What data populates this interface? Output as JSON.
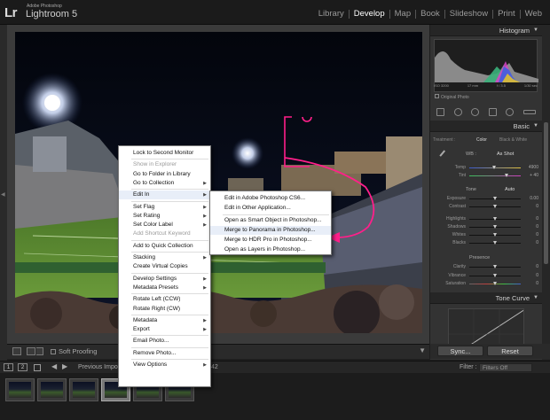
{
  "app": {
    "logo": "Lr",
    "vendor": "Adobe Photoshop",
    "name": "Lightroom 5"
  },
  "modules": [
    {
      "label": "Library",
      "active": false
    },
    {
      "label": "Develop",
      "active": true
    },
    {
      "label": "Map",
      "active": false
    },
    {
      "label": "Book",
      "active": false
    },
    {
      "label": "Slideshow",
      "active": false
    },
    {
      "label": "Print",
      "active": false
    },
    {
      "label": "Web",
      "active": false
    }
  ],
  "toolbar": {
    "soft_proofing": "Soft Proofing"
  },
  "right_panel": {
    "histogram_title": "Histogram",
    "hist_info": [
      "ISO 3200",
      "17 mm",
      "f / 3.5",
      "1/30 sec"
    ],
    "original_photo": "Original Photo",
    "basic_title": "Basic",
    "treatment": [
      "Treatment :",
      "Color",
      "Black & White"
    ],
    "wb_label": "WB :",
    "wb_value": "As Shot",
    "temp_label": "Temp",
    "temp_value": "4900",
    "tint_label": "Tint",
    "tint_value": "+ 40",
    "tone_label": "Tone",
    "tone_auto": "Auto",
    "exposure_label": "Exposure",
    "exposure_value": "0.00",
    "contrast_label": "Contrast",
    "contrast_value": "0",
    "highlights_label": "Highlights",
    "highlights_value": "0",
    "shadows_label": "Shadows",
    "shadows_value": "0",
    "whites_label": "Whites",
    "whites_value": "0",
    "blacks_label": "Blacks",
    "blacks_value": "0",
    "presence_label": "Presence",
    "clarity_label": "Clarity",
    "clarity_value": "0",
    "vibrance_label": "Vibrance",
    "vibrance_value": "0",
    "saturation_label": "Saturation",
    "saturation_value": "0",
    "tone_curve_title": "Tone Curve"
  },
  "buttons": {
    "sync": "Sync...",
    "reset": "Reset"
  },
  "filmbar": {
    "btn1": "1",
    "btn2": "2",
    "source": "Previous Import",
    "count": "42",
    "filter_label": "Filter :",
    "filter_value": "Filters Off"
  },
  "context_menu": [
    {
      "label": "Lock to Second Monitor",
      "disabled": false,
      "submenu": false
    },
    {
      "sep": true
    },
    {
      "label": "Show in Explorer",
      "disabled": true,
      "submenu": false
    },
    {
      "label": "Go to Folder in Library",
      "disabled": false,
      "submenu": false
    },
    {
      "label": "Go to Collection",
      "disabled": false,
      "submenu": true
    },
    {
      "sep": true
    },
    {
      "label": "Edit In",
      "disabled": false,
      "submenu": true,
      "highlight": true
    },
    {
      "sep": true
    },
    {
      "label": "Set Flag",
      "disabled": false,
      "submenu": true
    },
    {
      "label": "Set Rating",
      "disabled": false,
      "submenu": true
    },
    {
      "label": "Set Color Label",
      "disabled": false,
      "submenu": true
    },
    {
      "label": "Add Shortcut Keyword",
      "disabled": true,
      "submenu": false
    },
    {
      "sep": true
    },
    {
      "label": "Add to Quick Collection",
      "disabled": false,
      "submenu": false
    },
    {
      "sep": true
    },
    {
      "label": "Stacking",
      "disabled": false,
      "submenu": true
    },
    {
      "label": "Create Virtual Copies",
      "disabled": false,
      "submenu": false
    },
    {
      "sep": true
    },
    {
      "label": "Develop Settings",
      "disabled": false,
      "submenu": true
    },
    {
      "label": "Metadata Presets",
      "disabled": false,
      "submenu": true
    },
    {
      "sep": true
    },
    {
      "label": "Rotate Left (CCW)",
      "disabled": false,
      "submenu": false
    },
    {
      "label": "Rotate Right (CW)",
      "disabled": false,
      "submenu": false
    },
    {
      "sep": true
    },
    {
      "label": "Metadata",
      "disabled": false,
      "submenu": true
    },
    {
      "label": "Export",
      "disabled": false,
      "submenu": true
    },
    {
      "sep": true
    },
    {
      "label": "Email Photo...",
      "disabled": false,
      "submenu": false
    },
    {
      "sep": true
    },
    {
      "label": "Remove Photo...",
      "disabled": false,
      "submenu": false
    },
    {
      "sep": true
    },
    {
      "label": "View Options",
      "disabled": false,
      "submenu": true
    }
  ],
  "edit_in_submenu": [
    {
      "label": "Edit in Adobe Photoshop CS6..."
    },
    {
      "label": "Edit in Other Application..."
    },
    {
      "sep": true
    },
    {
      "label": "Open as Smart Object in Photoshop..."
    },
    {
      "label": "Merge to Panorama in Photoshop...",
      "highlight": true
    },
    {
      "label": "Merge to HDR Pro in Photoshop..."
    },
    {
      "label": "Open as Layers in Photoshop..."
    }
  ],
  "colors": {
    "annotation": "#ff1f8a",
    "active_module": "#ffffff",
    "menu_highlight": "#e8eef8"
  }
}
